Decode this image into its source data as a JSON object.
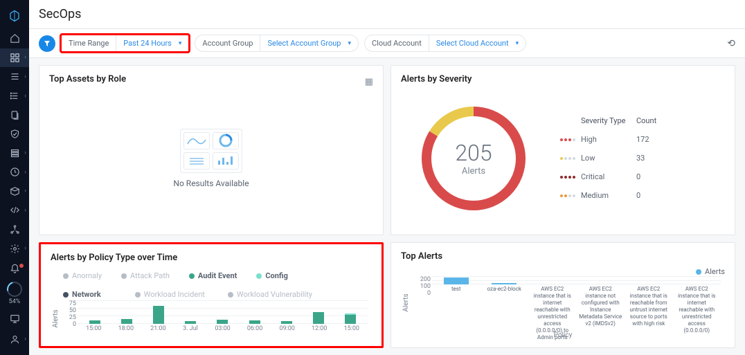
{
  "page_title": "SecOps",
  "sidebar": {
    "gauge_pct": "54%"
  },
  "filters": {
    "time_range_label": "Time Range",
    "time_range_value": "Past 24 Hours",
    "account_group_label": "Account Group",
    "account_group_value": "Select Account Group",
    "cloud_account_label": "Cloud Account",
    "cloud_account_value": "Select Cloud Account"
  },
  "panels": {
    "top_assets": {
      "title": "Top Assets by Role",
      "empty": "No Results Available"
    },
    "severity": {
      "title": "Alerts by Severity",
      "total": "205",
      "total_label": "Alerts",
      "head_type": "Severity Type",
      "head_count": "Count",
      "rows": [
        {
          "name": "High",
          "count": "172",
          "color": "#d94b4b"
        },
        {
          "name": "Low",
          "count": "33",
          "color": "#e9c94c"
        },
        {
          "name": "Critical",
          "count": "0",
          "color": "#8e2a2a"
        },
        {
          "name": "Medium",
          "count": "0",
          "color": "#e89b3c"
        }
      ]
    },
    "timeseries": {
      "title": "Alerts by Policy Type over Time",
      "y_label": "Alerts",
      "legend": {
        "anomaly": "Anomaly",
        "attack_path": "Attack Path",
        "audit": "Audit Event",
        "config": "Config",
        "network": "Network",
        "workload_incident": "Workload Incident",
        "workload_vuln": "Workload Vulnerability"
      }
    },
    "top_alerts": {
      "title": "Top Alerts",
      "legend": "Alerts",
      "y_label": "Alerts",
      "x_label": "Policy"
    }
  },
  "chart_data": [
    {
      "type": "bar",
      "id": "alerts_by_policy_type_over_time",
      "title": "Alerts by Policy Type over Time",
      "ylabel": "Alerts",
      "ylim": [
        0,
        75
      ],
      "yticks": [
        0,
        25,
        50,
        75
      ],
      "categories": [
        "15:00",
        "18:00",
        "21:00",
        "3. Jul",
        "03:00",
        "06:00",
        "09:00",
        "12:00",
        "15:00"
      ],
      "series": [
        {
          "name": "Audit Event",
          "color": "#3aa589",
          "values": [
            12,
            15,
            58,
            9,
            14,
            11,
            10,
            38,
            30
          ]
        },
        {
          "name": "Config",
          "color": "#7be0cb",
          "values": [
            0,
            0,
            0,
            0,
            0,
            0,
            0,
            0,
            4
          ]
        }
      ]
    },
    {
      "type": "bar",
      "id": "top_alerts",
      "title": "Top Alerts",
      "ylabel": "Alerts",
      "xlabel": "Policy",
      "ylim": [
        0,
        200
      ],
      "yticks": [
        0,
        100,
        200
      ],
      "categories": [
        "test",
        "oza-ec2-block",
        "AWS EC2 instance that is internet reachable with unrestricted access (0.0.0.0/0) to Admin ports",
        "AWS EC2 instance not configured with Instance Metadata Service v2 (IMDSv2)",
        "AWS EC2 instance that is reachable from untrust internet source to ports with high risk",
        "AWS EC2 instance that is internet reachable with unrestricted access (0.0.0.0/0)"
      ],
      "series": [
        {
          "name": "Alerts",
          "color": "#5ab5e8",
          "values": [
            165,
            32,
            0,
            0,
            0,
            0
          ]
        }
      ]
    },
    {
      "type": "pie",
      "id": "alerts_by_severity",
      "title": "Alerts by Severity",
      "total": 205,
      "slices": [
        {
          "name": "High",
          "value": 172,
          "color": "#d94b4b"
        },
        {
          "name": "Low",
          "value": 33,
          "color": "#e9c94c"
        },
        {
          "name": "Critical",
          "value": 0,
          "color": "#8e2a2a"
        },
        {
          "name": "Medium",
          "value": 0,
          "color": "#e89b3c"
        }
      ]
    }
  ]
}
